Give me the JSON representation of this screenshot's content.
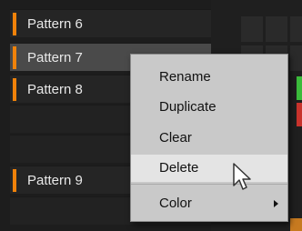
{
  "patterns": [
    {
      "label": "Pattern 6",
      "has_color": true,
      "selected": false
    },
    {
      "label": "Pattern 7",
      "has_color": true,
      "selected": true
    },
    {
      "label": "Pattern 8",
      "has_color": true,
      "selected": false
    },
    {
      "label": "",
      "has_color": false,
      "selected": false
    },
    {
      "label": "",
      "has_color": false,
      "selected": false
    },
    {
      "label": "Pattern 9",
      "has_color": true,
      "selected": false
    },
    {
      "label": "",
      "has_color": false,
      "selected": false
    }
  ],
  "pattern_color": "#f0820a",
  "context_menu": {
    "items": [
      {
        "label": "Rename"
      },
      {
        "label": "Duplicate"
      },
      {
        "label": "Clear"
      },
      {
        "label": "Delete",
        "hovered": true
      },
      {
        "label": "Color",
        "has_submenu": true
      }
    ]
  }
}
